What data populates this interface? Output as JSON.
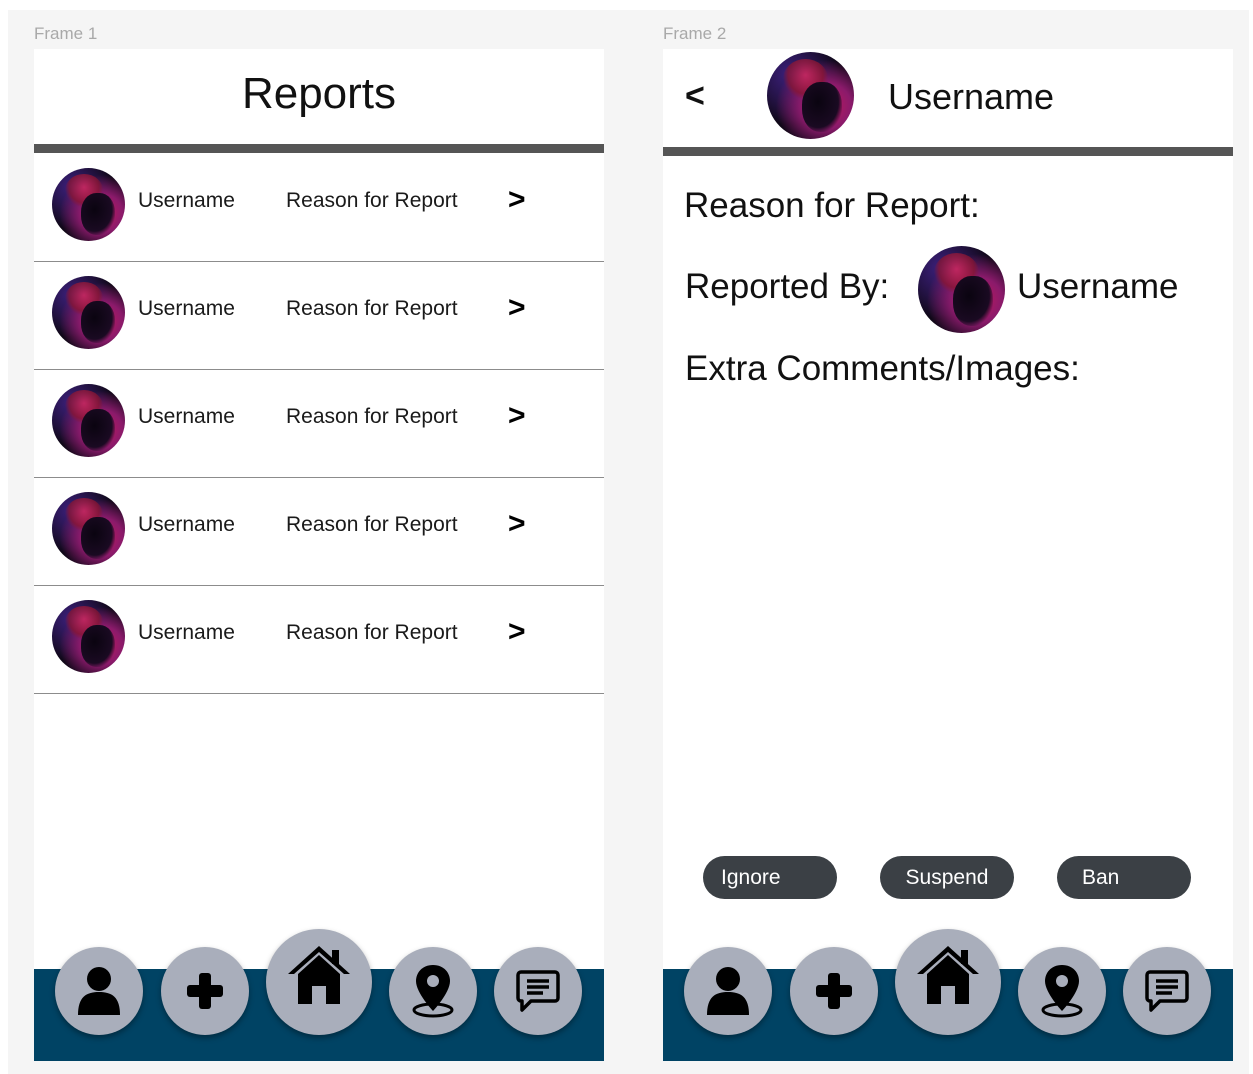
{
  "frames": [
    {
      "label": "Frame 1",
      "title": "Reports",
      "reports": [
        {
          "username": "Username",
          "reason": "Reason for Report",
          "chevron": ">"
        },
        {
          "username": "Username",
          "reason": "Reason for Report",
          "chevron": ">"
        },
        {
          "username": "Username",
          "reason": "Reason for Report",
          "chevron": ">"
        },
        {
          "username": "Username",
          "reason": "Reason for Report",
          "chevron": ">"
        },
        {
          "username": "Username",
          "reason": "Reason for Report",
          "chevron": ">"
        }
      ]
    },
    {
      "label": "Frame 2",
      "back": "<",
      "header_username": "Username",
      "reason_label": "Reason for Report:",
      "reported_by_label": "Reported By:",
      "reporter_username": "Username",
      "extra_label": "Extra Comments/Images:",
      "actions": {
        "ignore": "Ignore",
        "suspend": "Suspend",
        "ban": "Ban"
      }
    }
  ],
  "nav": {
    "icons": [
      "person-icon",
      "plus-icon",
      "home-icon",
      "map-pin-icon",
      "chat-icon"
    ]
  },
  "colors": {
    "nav_band": "#004364",
    "nav_button": "#a9aebb",
    "action_button": "#3b4045",
    "divider": "#555555",
    "canvas": "#f5f5f5"
  }
}
